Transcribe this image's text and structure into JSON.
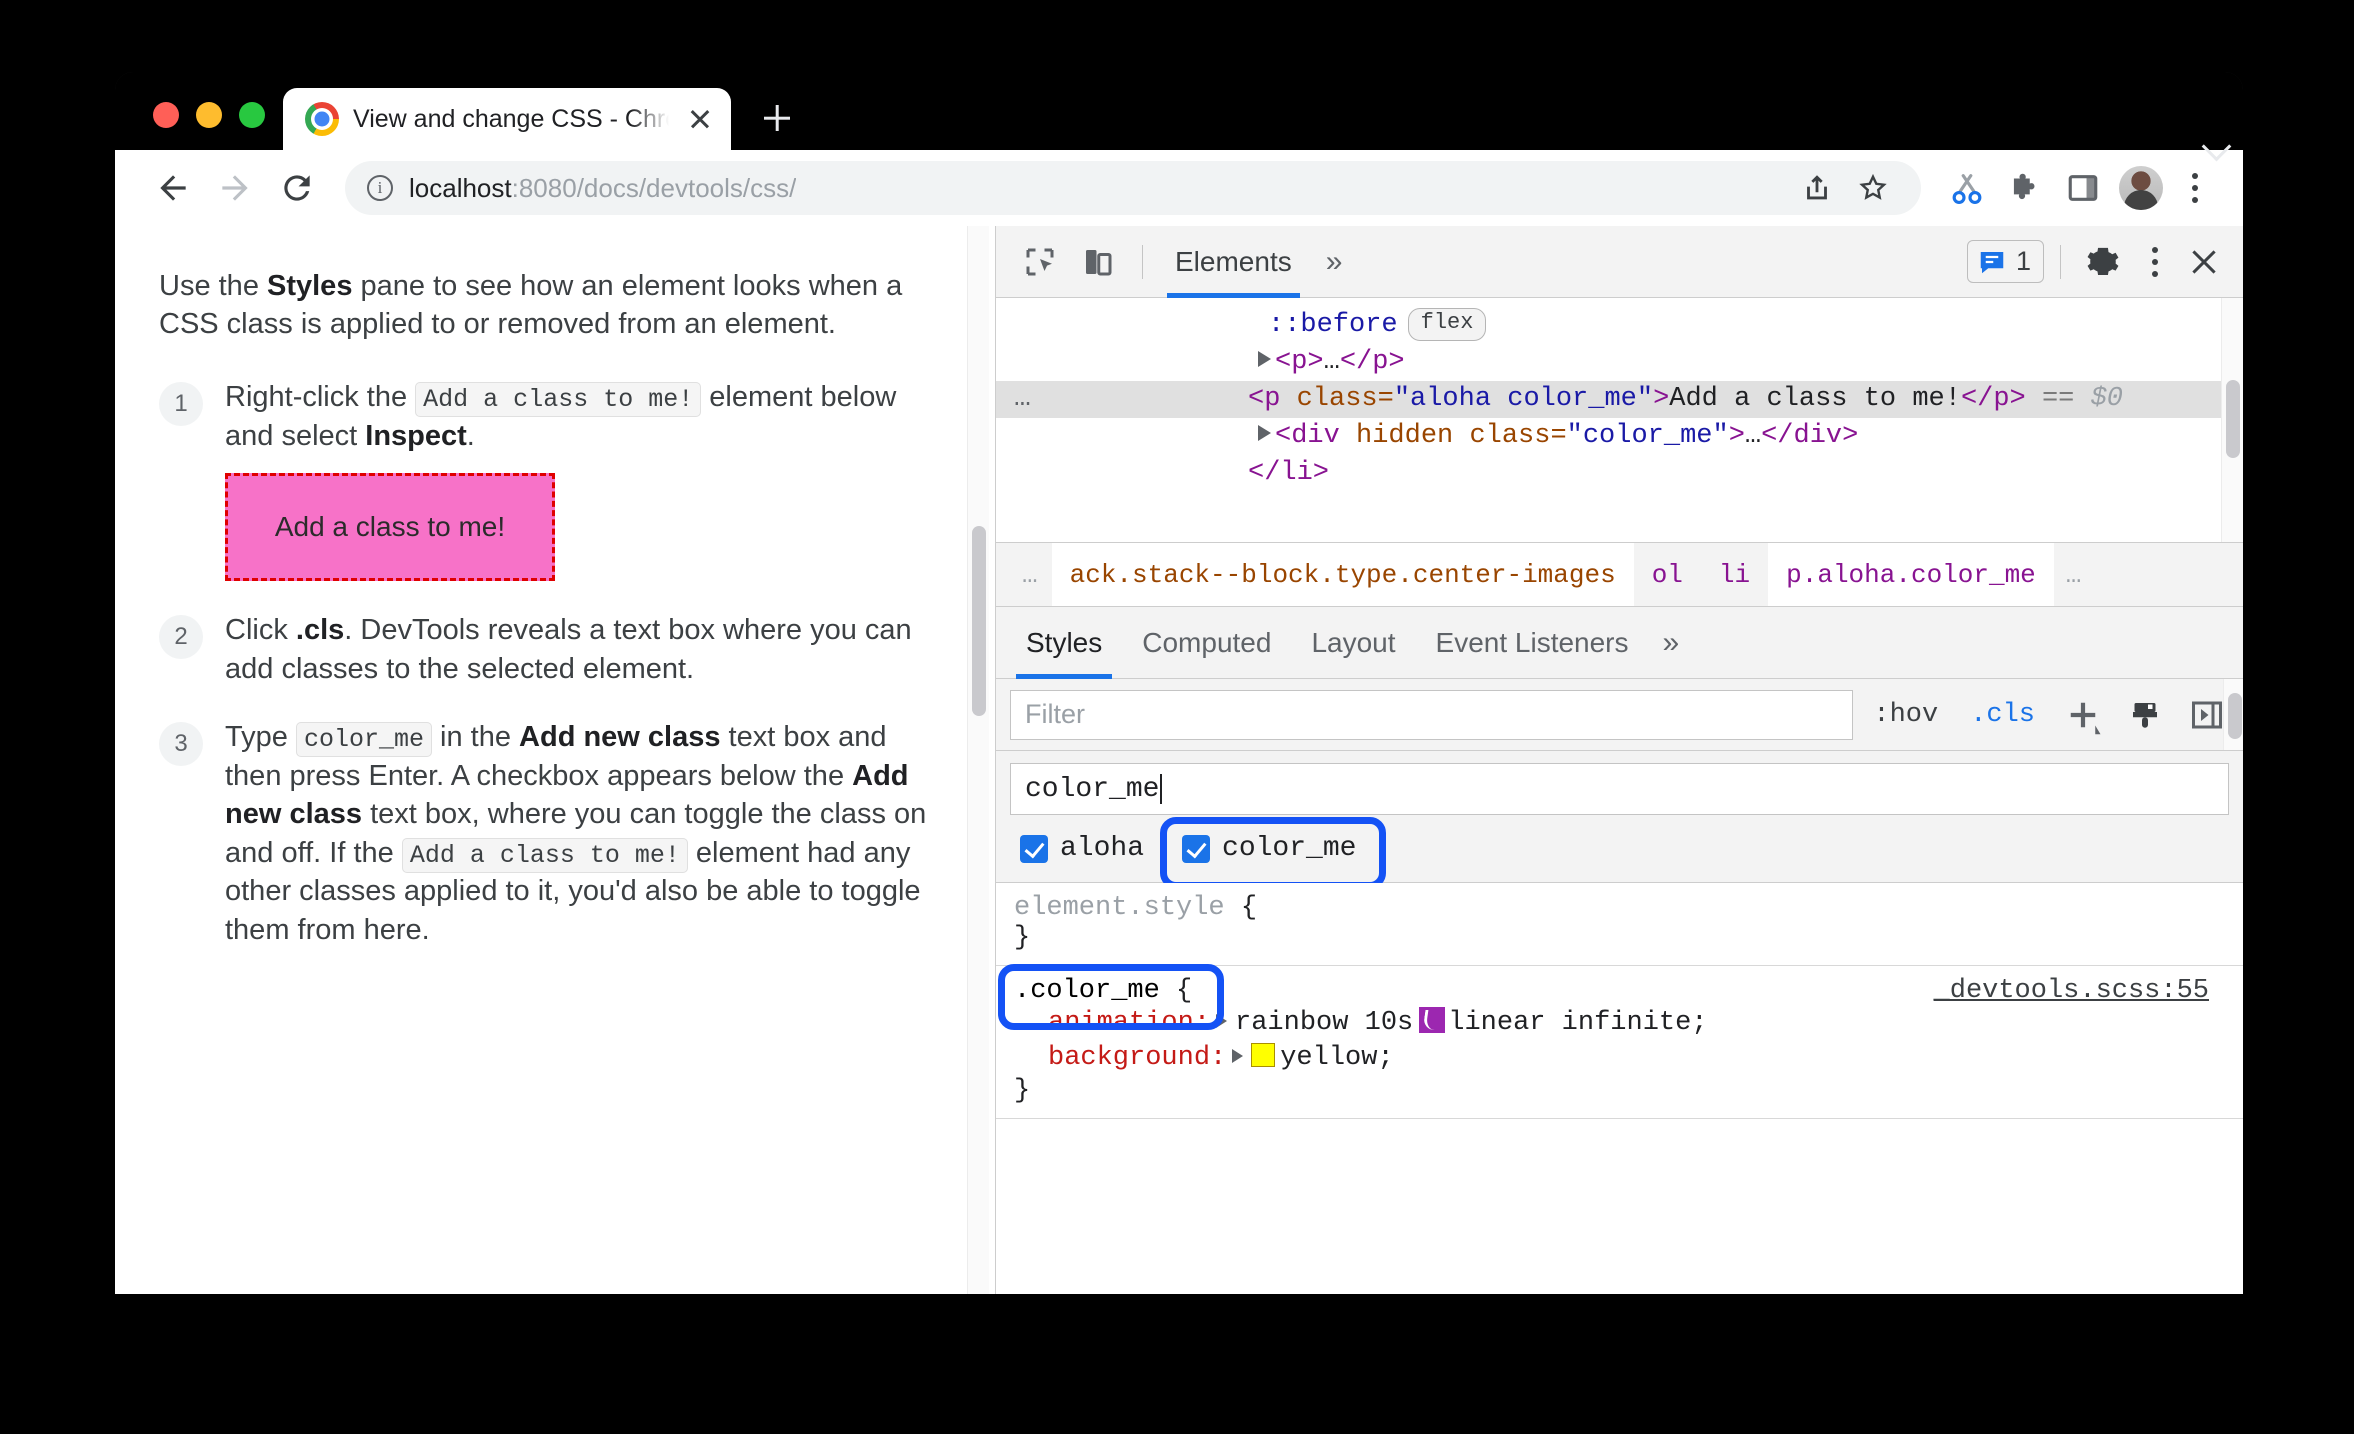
{
  "browser": {
    "tab_title": "View and change CSS - Chrom",
    "url_host": "localhost",
    "url_path": ":8080/docs/devtools/css/",
    "new_tab_label": "+",
    "icons": {
      "back": "back-arrow-icon",
      "forward": "forward-arrow-icon",
      "reload": "reload-icon",
      "info": "info-icon",
      "share": "share-icon",
      "bookmark": "star-icon",
      "scissors": "scissors-icon",
      "extensions": "puzzle-icon",
      "side_panel": "side-panel-icon",
      "profile": "avatar-icon",
      "menu": "kebab-menu-icon",
      "tab_list": "chevron-down-icon"
    }
  },
  "page": {
    "intro_pre": "Use the ",
    "intro_bold": "Styles",
    "intro_post": " pane to see how an element looks when a CSS class is applied to or removed from an element.",
    "steps": [
      {
        "num": "1",
        "t1": "Right-click the ",
        "code1": "Add a class to me!",
        "t2": " element below and select ",
        "b1": "Inspect",
        "t3": "."
      },
      {
        "num": "2",
        "t1": "Click ",
        "b1": ".cls",
        "t2": ". DevTools reveals a text box where you can add classes to the selected element."
      },
      {
        "num": "3",
        "t1": "Type ",
        "code1": "color_me",
        "t2": " in the ",
        "b1": "Add new class",
        "t3": " text box and then press Enter. A checkbox appears below the ",
        "b2": "Add new class",
        "t4": " text box, where you can toggle the class on and off. If the ",
        "code2": "Add a class to me!",
        "t5": " element had any other classes applied to it, you'd also be able to toggle them from here."
      }
    ],
    "demo_box_label": "Add a class to me!"
  },
  "devtools": {
    "header": {
      "tabs": [
        "Elements"
      ],
      "more": "»",
      "message_count": "1",
      "icons": {
        "inspect": "inspect-cursor-icon",
        "device": "device-toolbar-icon",
        "messages": "message-bubble-icon",
        "settings": "gear-icon",
        "menu": "kebab-menu-icon",
        "close": "close-icon"
      }
    },
    "dom": {
      "rows": [
        {
          "type": "pseudo",
          "text": "::before",
          "badge": "flex"
        },
        {
          "type": "collapsed",
          "tag_open": "<p>",
          "ellipsis": "…",
          "tag_close": "</p>"
        },
        {
          "type": "selected",
          "tag": "<p",
          "attr_name": "class",
          "attr_value": "\"aloha color_me\"",
          "gt": ">",
          "text": "Add a class to me!",
          "close": "</p>",
          "marker": "==",
          "ref": "$0",
          "handle": "…"
        },
        {
          "type": "collapsed-attr",
          "tag": "<div",
          "attr_bool": "hidden",
          "attr_name": "class",
          "attr_value": "\"color_me\"",
          "gt": ">",
          "ellipsis": "…",
          "close": "</div>"
        },
        {
          "type": "plain",
          "text": "</li>"
        }
      ]
    },
    "breadcrumb": {
      "leading_ellipsis": "…",
      "items": [
        {
          "label": "ack.stack--block.type.center-images",
          "kind": "cls"
        },
        {
          "label": "ol",
          "kind": "el"
        },
        {
          "label": "li",
          "kind": "el"
        },
        {
          "label": "p.aloha.color_me",
          "kind": "sel"
        }
      ],
      "trailing_ellipsis": "…"
    },
    "styles_tabs": {
      "items": [
        "Styles",
        "Computed",
        "Layout",
        "Event Listeners"
      ],
      "active": "Styles",
      "more": "»"
    },
    "filter_row": {
      "placeholder": "Filter",
      "hov_label": ":hov",
      "cls_label": ".cls",
      "add_label": "+",
      "icons": {
        "add_rule": "plus-icon",
        "copy_styles": "paintbrush-icon",
        "toggle_sidebar": "sidebar-toggle-icon"
      }
    },
    "class_editor": {
      "input_value": "color_me",
      "classes": [
        {
          "name": "aloha",
          "checked": true
        },
        {
          "name": "color_me",
          "checked": true
        }
      ]
    },
    "rules": [
      {
        "selector": "element.style",
        "open_brace": "{",
        "close_brace": "}",
        "source": "",
        "declarations": []
      },
      {
        "selector": ".color_me",
        "open_brace": "{",
        "close_brace": "}",
        "source": "_devtools.scss:55",
        "declarations": [
          {
            "property": "animation",
            "value": "rainbow 10s linear infinite;",
            "swatch": "easing"
          },
          {
            "property": "background",
            "value": "yellow;",
            "swatch": "color",
            "swatch_color": "#ffff00"
          }
        ]
      }
    ]
  },
  "colors": {
    "accent_blue": "#1a73e8",
    "annotation_ring": "#1452f5",
    "tag_purple": "#881391",
    "attr_orange": "#994500",
    "attr_value_blue": "#1a1aa6",
    "property_red": "#c41a16",
    "demo_pink": "#f772c8",
    "demo_border": "#e00000"
  }
}
